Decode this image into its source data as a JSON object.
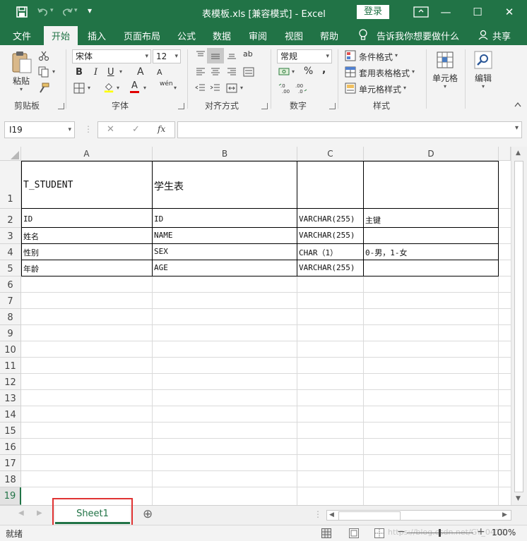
{
  "window": {
    "title": "表模板.xls  [兼容模式]  -  Excel",
    "login": "登录",
    "min": "—",
    "max": "☐",
    "close": "✕"
  },
  "qat": {
    "save_icon": "save-icon",
    "undo_icon": "undo-icon",
    "redo_icon": "redo-icon",
    "customize": "▾"
  },
  "menu": {
    "tabs": [
      "文件",
      "开始",
      "插入",
      "页面布局",
      "公式",
      "数据",
      "审阅",
      "视图",
      "帮助"
    ],
    "tell_me": "告诉我你想要做什么",
    "share": "共享"
  },
  "ribbon": {
    "clipboard": {
      "label": "剪贴板",
      "paste": "粘贴"
    },
    "font": {
      "label": "字体",
      "name": "宋体",
      "size": "12",
      "bold": "B",
      "italic": "I",
      "underline": "U",
      "grow": "A",
      "shrink": "A",
      "wen": "wén",
      "font_color_letter": "A"
    },
    "alignment": {
      "label": "对齐方式",
      "ab": "ab"
    },
    "number": {
      "label": "数字",
      "format": "常规",
      "percent": "%",
      "comma": ",",
      "inc": "←.0\n.00",
      "dec": ".00\n→.0"
    },
    "styles": {
      "label": "样式",
      "conditional": "条件格式",
      "table": "套用表格格式",
      "cell": "单元格样式"
    },
    "cells": {
      "label": "单元格"
    },
    "editing": {
      "label": "编辑"
    }
  },
  "formula_bar": {
    "name_box": "I19",
    "cancel": "✕",
    "enter": "✓",
    "fx": "fx",
    "formula": ""
  },
  "grid": {
    "columns": [
      "A",
      "B",
      "C",
      "D"
    ],
    "rows": [
      "1",
      "2",
      "3",
      "4",
      "5",
      "6",
      "7",
      "8",
      "9",
      "10",
      "11",
      "12",
      "13",
      "14",
      "15",
      "16",
      "17",
      "18",
      "19"
    ],
    "cells": {
      "A1": "T_STUDENT",
      "B1": "学生表",
      "A2": "ID",
      "B2": "ID",
      "C2": "VARCHAR(255)",
      "D2": "主键",
      "A3": "姓名",
      "B3": "NAME",
      "C3": "VARCHAR(255)",
      "A4": "性别",
      "B4": "SEX",
      "C4": "CHAR（1）",
      "D4": "0-男，1-女",
      "A5": "年龄",
      "B5": "AGE",
      "C5": "VARCHAR(255)"
    }
  },
  "sheets": {
    "active": "Sheet1",
    "add": "⊕"
  },
  "status": {
    "ready": "就绪",
    "zoom": "100%",
    "watermark": "https://blog.csdn.net/GY_0412"
  },
  "colors": {
    "excel_green": "#217346",
    "highlight_red": "#e03333"
  }
}
